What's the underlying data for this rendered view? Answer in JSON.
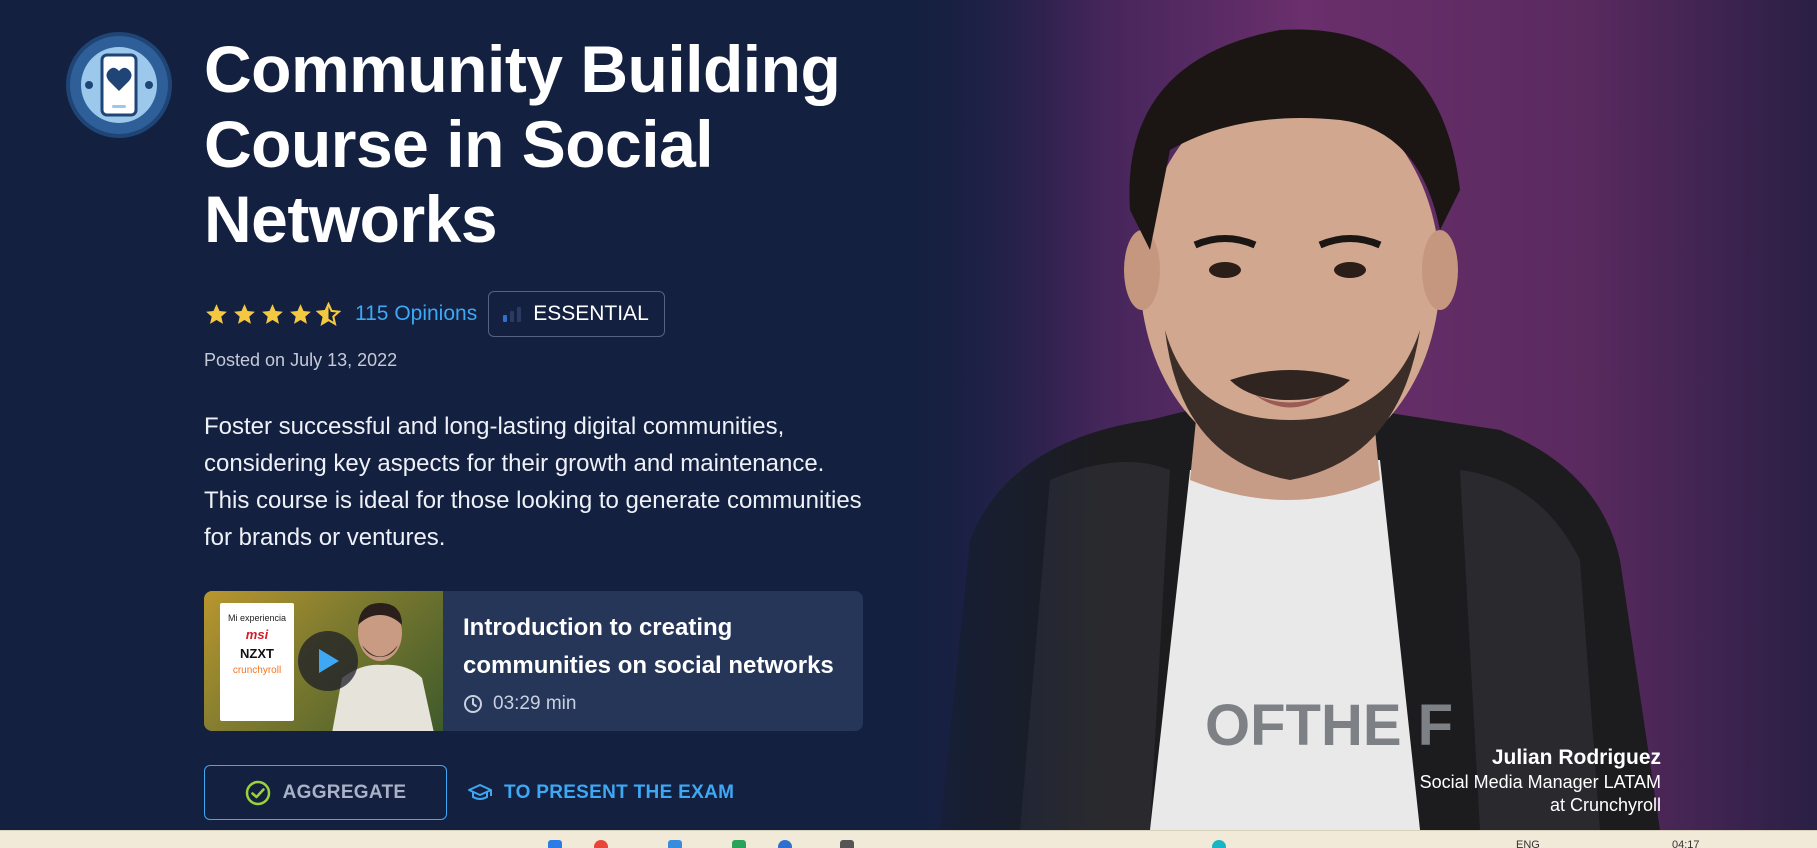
{
  "course": {
    "title": "Community Building Course in Social Networks",
    "rating": 4.5,
    "opinions_label": "115 Opinions",
    "level_label": "ESSENTIAL",
    "posted": "Posted on July 13, 2022",
    "description": "Foster successful and long-lasting digital communities, considering key aspects for their growth and maintenance. This course is ideal for those looking to generate communities for brands or ventures."
  },
  "video": {
    "title": "Introduction to creating communities on social networks",
    "duration": "03:29 min",
    "thumbnail_text": {
      "line1": "Mi experiencia",
      "line2": "msi",
      "line3": "NZXT",
      "line4": "crunchyroll"
    }
  },
  "actions": {
    "aggregate_label": "AGGREGATE",
    "exam_label": "TO PRESENT THE EXAM"
  },
  "instructor": {
    "name": "Julian Rodriguez",
    "role_line1": "Social Media Manager LATAM",
    "role_line2": "at Crunchyroll"
  },
  "taskbar": {
    "lang": "ENG",
    "time": "04:17"
  },
  "colors": {
    "background": "#13203f",
    "accent": "#3ea8f5",
    "star": "#f5c842",
    "card": "#263659",
    "photo_bg": "#6a2f6c"
  },
  "icons": {
    "course": "phone-heart-icon",
    "level": "signal-bars-icon",
    "play": "play-icon",
    "clock": "clock-icon",
    "check": "check-circle-icon",
    "exam": "graduation-cap-icon"
  }
}
